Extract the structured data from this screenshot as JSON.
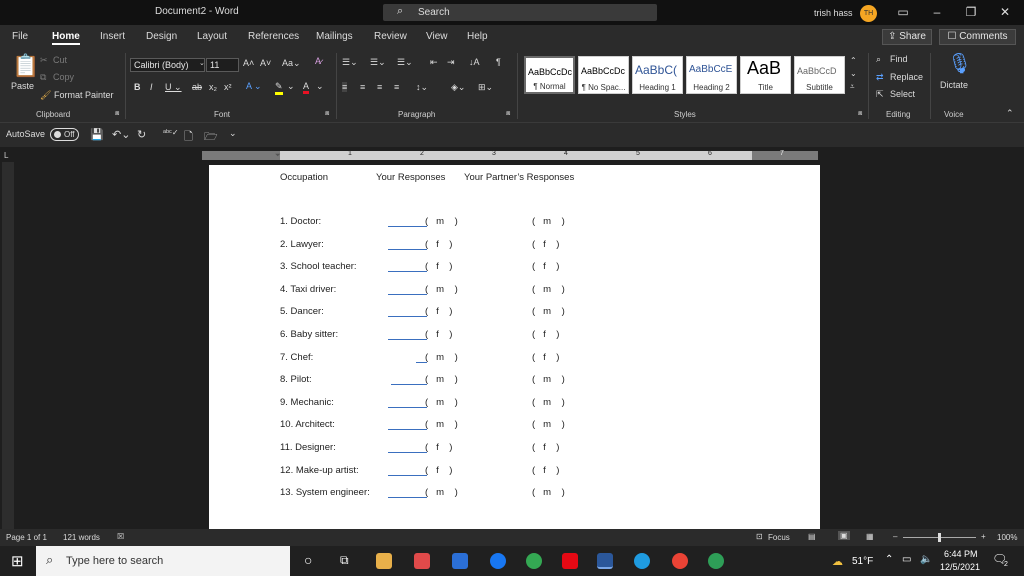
{
  "window": {
    "title": "Document2 - Word",
    "search": "Search",
    "user": "trish hass",
    "initials": "TH"
  },
  "menu": [
    "File",
    "Home",
    "Insert",
    "Design",
    "Layout",
    "References",
    "Mailings",
    "Review",
    "View",
    "Help"
  ],
  "share_label": "Share",
  "comments_label": "Comments",
  "clipboard": {
    "paste": "Paste",
    "cut": "Cut",
    "copy": "Copy",
    "format_painter": "Format Painter",
    "label": "Clipboard"
  },
  "font": {
    "name": "Calibri (Body)",
    "size": "11",
    "label": "Font"
  },
  "paragraph": {
    "label": "Paragraph"
  },
  "styles": {
    "label": "Styles",
    "items": [
      {
        "sample": "AaBbCcDc",
        "name": "¶ Normal"
      },
      {
        "sample": "AaBbCcDc",
        "name": "¶ No Spac..."
      },
      {
        "sample": "AaBbC(",
        "name": "Heading 1"
      },
      {
        "sample": "AaBbCcE",
        "name": "Heading 2"
      },
      {
        "sample": "AaB",
        "name": "Title"
      },
      {
        "sample": "AaBbCcD",
        "name": "Subtitle"
      }
    ]
  },
  "editing": {
    "find": "Find",
    "replace": "Replace",
    "select": "Select",
    "label": "Editing"
  },
  "voice": {
    "dictate": "Dictate",
    "label": "Voice"
  },
  "autosave": {
    "label": "AutoSave",
    "state": "Off"
  },
  "ruler_numbers": [
    "1",
    "2",
    "3",
    "4",
    "5",
    "6",
    "7"
  ],
  "document": {
    "headers": {
      "occupation": "Occupation",
      "yours": "Your Responses",
      "partner": "Your Partner’s Responses"
    },
    "rows": [
      {
        "occ": "1. Doctor:",
        "mine": "m",
        "partner": "m"
      },
      {
        "occ": "2. Lawyer:",
        "mine": "f",
        "partner": "f"
      },
      {
        "occ": "3. School teacher:",
        "mine": "f",
        "partner": "f"
      },
      {
        "occ": "4. Taxi driver:",
        "mine": "m",
        "partner": "m"
      },
      {
        "occ": "5. Dancer:",
        "mine": "f",
        "partner": "m"
      },
      {
        "occ": "6. Baby sitter:",
        "mine": "f",
        "partner": "f"
      },
      {
        "occ": "7. Chef:",
        "mine": "m",
        "partner": "f"
      },
      {
        "occ": "8. Pilot:",
        "mine": "m",
        "partner": "m"
      },
      {
        "occ": "9. Mechanic:",
        "mine": "m",
        "partner": "m"
      },
      {
        "occ": "10. Architect:",
        "mine": "m",
        "partner": "m"
      },
      {
        "occ": "11. Designer:",
        "mine": "f",
        "partner": "f"
      },
      {
        "occ": "12. Make-up artist:",
        "mine": "f",
        "partner": "f"
      },
      {
        "occ": "13. System engineer:",
        "mine": "m",
        "partner": "m"
      }
    ]
  },
  "status": {
    "page": "Page 1 of 1",
    "words": "121 words",
    "focus": "Focus",
    "zoom": "100%"
  },
  "taskbar": {
    "search_placeholder": "Type here to search",
    "temp": "51°F",
    "time": "6:44 PM",
    "date": "12/5/2021",
    "notifications": "2"
  },
  "colors": {
    "accent": "#2b579a",
    "avatar": "#f5a623",
    "page": "#ffffff",
    "blank_line": "#3a6fbf"
  }
}
